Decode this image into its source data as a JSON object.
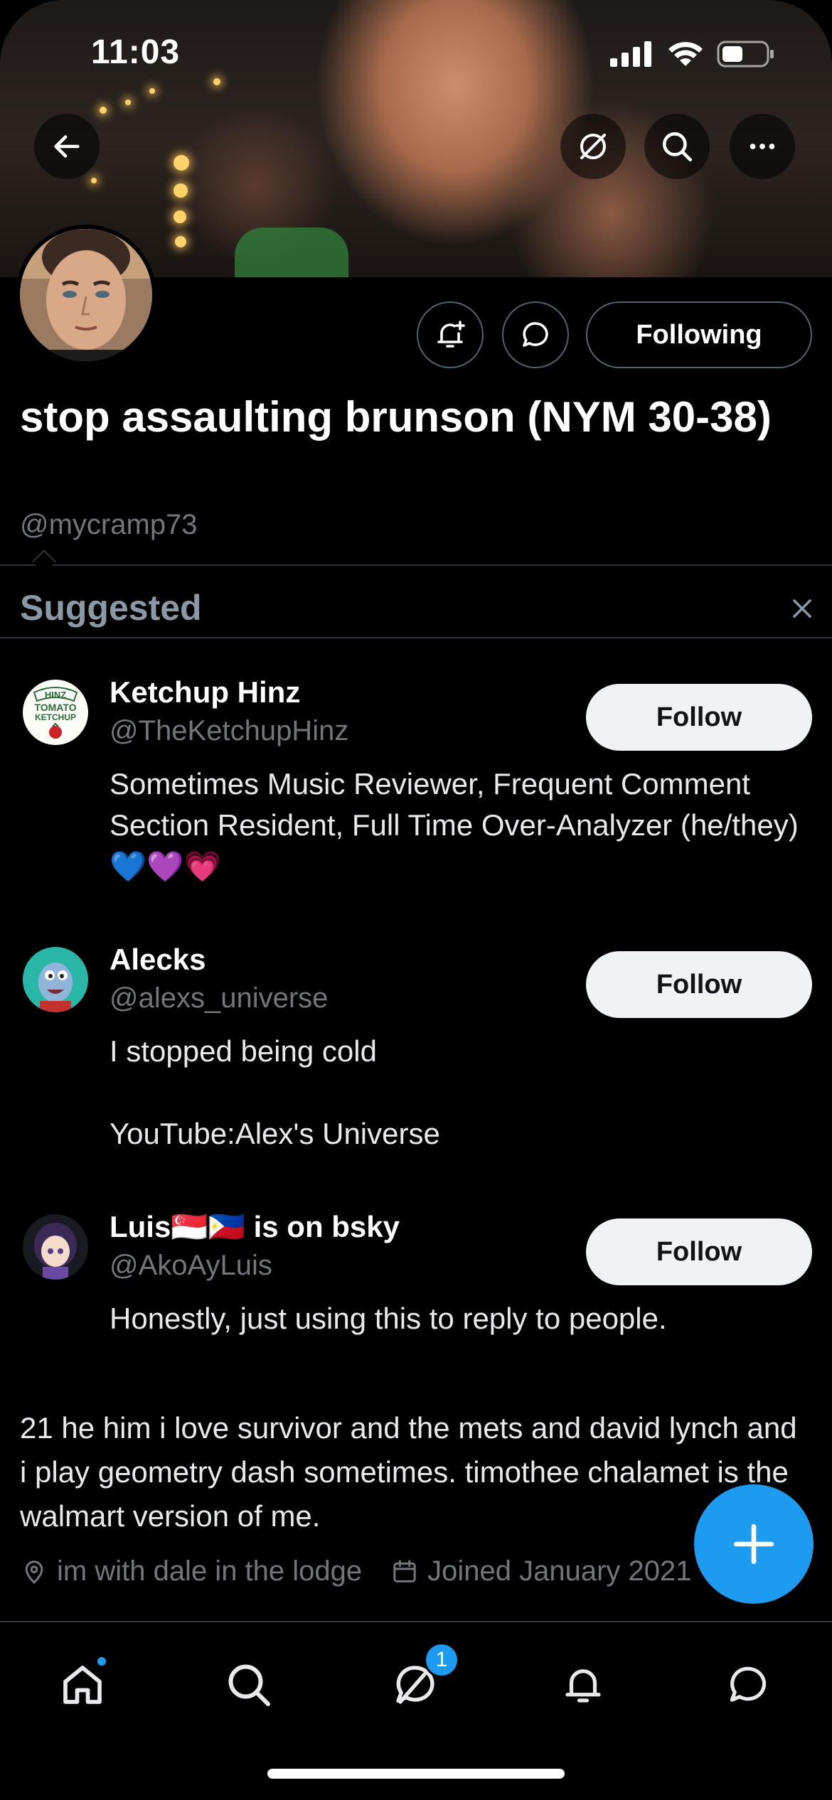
{
  "status_bar": {
    "time": "11:03"
  },
  "profile": {
    "display_name": "stop assaulting brunson (NYM 30-38)",
    "handle": "@mycramp73",
    "following_label": "Following",
    "bio": "21 he him i love survivor and the mets and david lynch and i play geometry dash sometimes. timothee chalamet is the walmart version of me.",
    "location": "im with dale in the lodge",
    "joined": "Joined January 2021"
  },
  "suggested": {
    "title": "Suggested",
    "follow_label": "Follow",
    "items": [
      {
        "name": "Ketchup Hinz",
        "handle": "@TheKetchupHinz",
        "bio": "Sometimes Music Reviewer, Frequent Comment Section Resident, Full Time Over-Analyzer (he/they) 💙💜💗",
        "avatar_text": [
          "HINZ",
          "TOMATO",
          "KETCHUP"
        ]
      },
      {
        "name": "Alecks",
        "handle": "@alexs_universe",
        "bio": "I stopped being cold\n\nYouTube:Alex's Universe"
      },
      {
        "name": "Luis🇸🇬🇵🇭 is on bsky",
        "handle": "@AkoAyLuis",
        "bio": "Honestly, just using this to reply to people."
      }
    ]
  },
  "tabbar": {
    "messages_badge": "1"
  },
  "colors": {
    "accent": "#1d9bf0",
    "background": "#000000",
    "muted": "#71767b"
  }
}
